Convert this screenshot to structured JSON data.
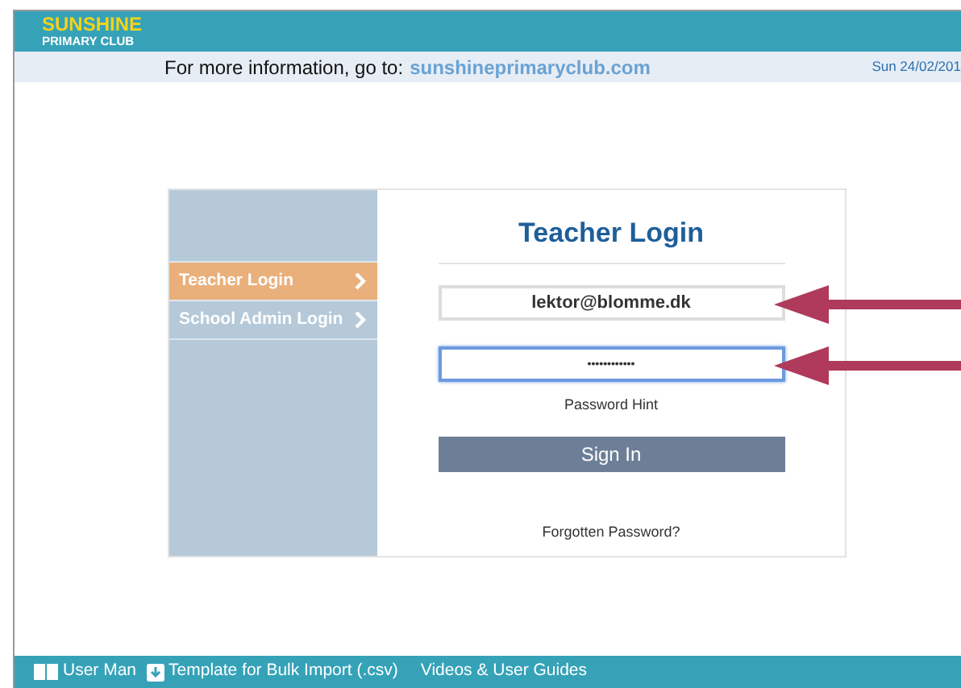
{
  "header": {
    "logo_line_1": "SUNSHINE",
    "logo_line_2": "PRIMARY CLUB"
  },
  "info_bar": {
    "text": "For more information, go to:",
    "link": "sunshineprimaryclub.com",
    "date": "Sun 24/02/201"
  },
  "sidebar": {
    "items": [
      {
        "label": "Teacher Login",
        "selected": true
      },
      {
        "label": "School Admin Login",
        "selected": false
      }
    ]
  },
  "login": {
    "title": "Teacher Login",
    "email": {
      "value": "lektor@blomme.dk",
      "focused": false,
      "arrow": true
    },
    "password": {
      "value": "••••••••••••",
      "focused": true,
      "arrow": true
    },
    "hint": "Password Hint",
    "button": "Sign In",
    "forgot": "Forgotten Password?"
  },
  "footer": {
    "links": [
      {
        "kind": "book",
        "label": "User Man"
      },
      {
        "kind": "download",
        "label": "Template for Bulk Import (.csv)"
      },
      {
        "kind": "none",
        "label": "Videos & User Guides"
      }
    ]
  }
}
